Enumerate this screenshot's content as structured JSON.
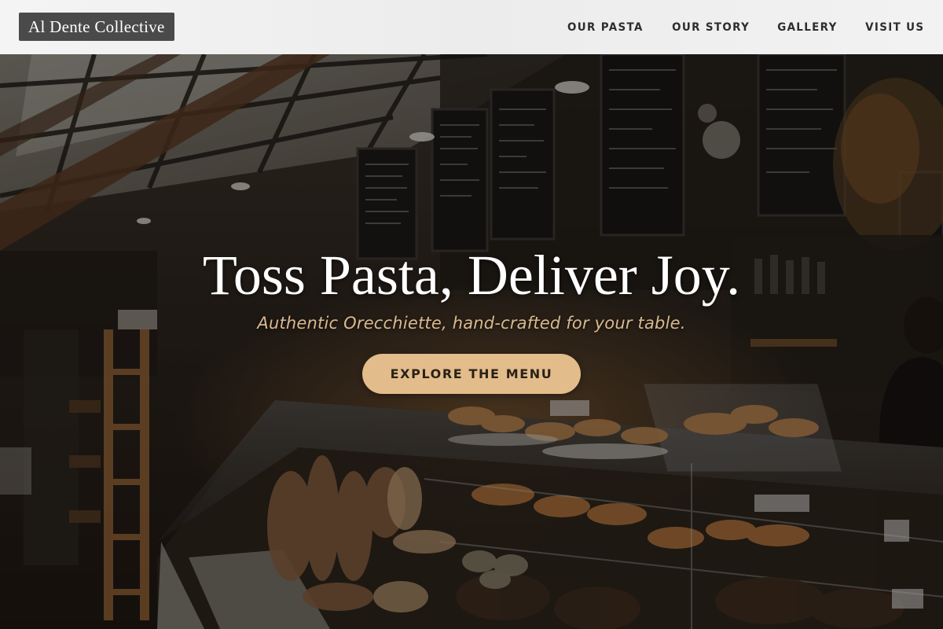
{
  "brand": {
    "name": "Al Dente Collective"
  },
  "nav": {
    "items": [
      {
        "label": "OUR PASTA"
      },
      {
        "label": "OUR STORY"
      },
      {
        "label": "GALLERY"
      },
      {
        "label": "VISIT US"
      }
    ]
  },
  "hero": {
    "headline": "Toss Pasta, Deliver Joy.",
    "tagline": "Authentic Orecchiette, hand-crafted for your table.",
    "cta_label": "EXPLORE THE MENU",
    "background": "market-bakery-photo"
  },
  "colors": {
    "accent": "#e2bc8a",
    "tagline": "#d9b98f",
    "header_bg": "#f0f0f0",
    "logo_bg": "#4a4a4a"
  }
}
